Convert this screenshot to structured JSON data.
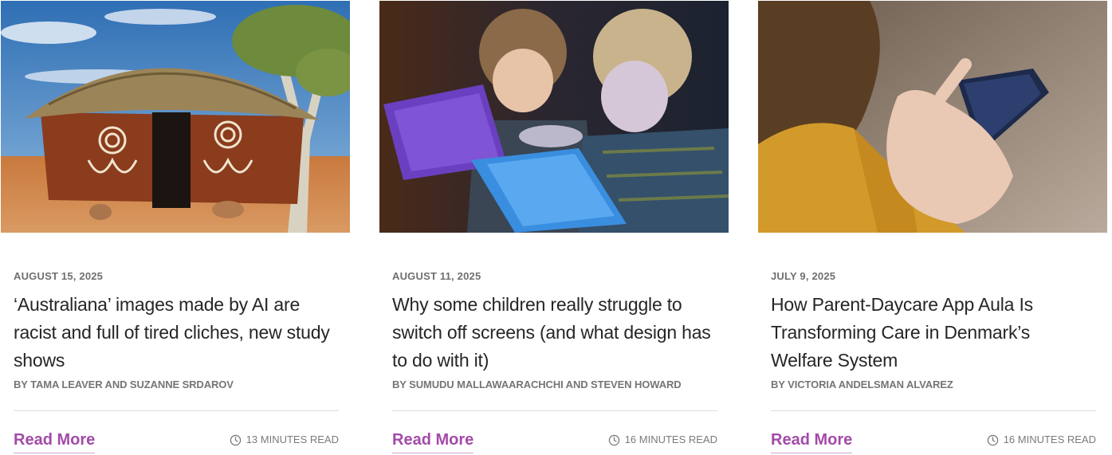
{
  "articles": [
    {
      "date": "AUGUST 15, 2025",
      "title": "‘Australiana’ images made by AI are racist and full of tired cliches, new study shows",
      "byline": "BY TAMA LEAVER AND SUZANNE SRDAROV",
      "read_more": "Read More",
      "read_time": "13 MINUTES READ"
    },
    {
      "date": "AUGUST 11, 2025",
      "title": "Why some children really struggle to switch off screens (and what design has to do with it)",
      "byline": "BY SUMUDU MALLAWAARACHCHI AND STEVEN HOWARD",
      "read_more": "Read More",
      "read_time": "16 MINUTES READ"
    },
    {
      "date": "JULY 9, 2025",
      "title": "How Parent-Daycare App Aula Is Transforming Care in Denmark’s Welfare System",
      "byline": "BY VICTORIA ANDELSMAN ALVAREZ",
      "read_more": "Read More",
      "read_time": "16 MINUTES READ"
    }
  ],
  "colors": {
    "accent": "#a34aa8",
    "meta_text": "#757575",
    "title_text": "#262626"
  },
  "icons": {
    "read_time": "clock-icon"
  }
}
